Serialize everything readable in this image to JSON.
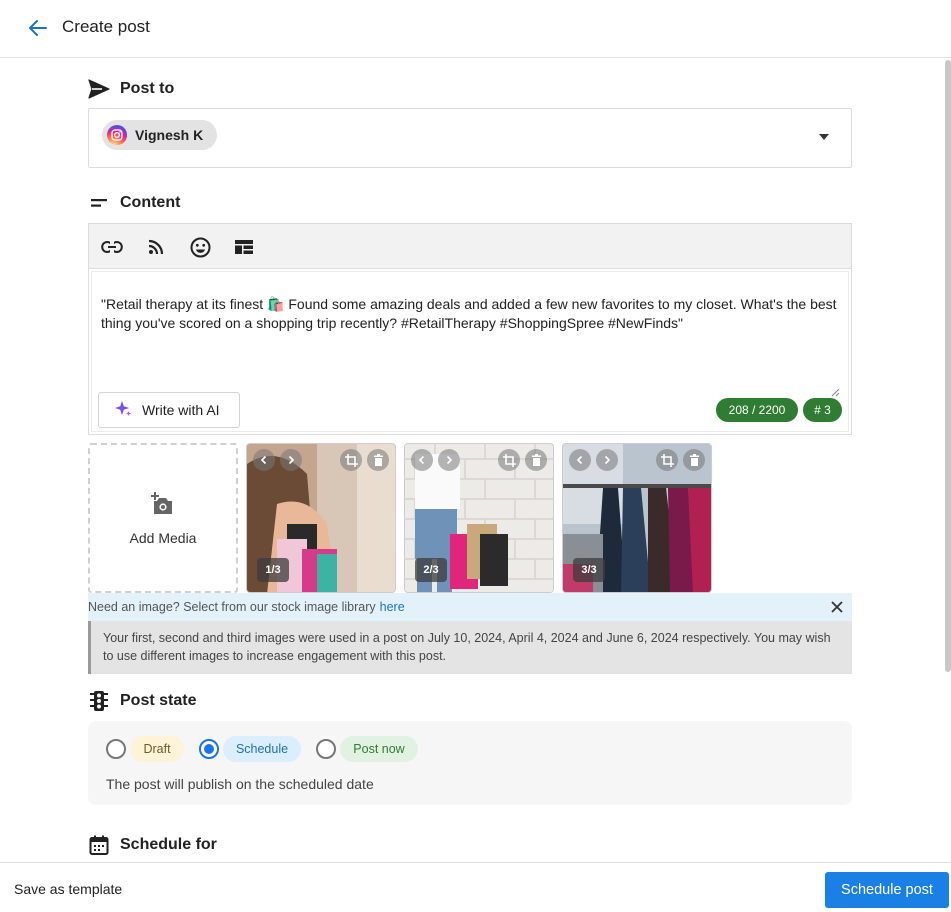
{
  "header": {
    "title": "Create post",
    "back_icon": "arrow-left-icon"
  },
  "post_to": {
    "heading": "Post to",
    "account_name": "Vignesh K",
    "account_icon": "instagram-icon"
  },
  "content": {
    "heading": "Content",
    "toolbar_icons": [
      "link-icon",
      "rss-icon",
      "emoji-icon",
      "layout-icon"
    ],
    "text": "\"Retail therapy at its finest 🛍️ Found some amazing deals and added a few new favorites to my closet. What's the best thing you've scored on a shopping trip recently? #RetailTherapy #ShoppingSpree #NewFinds\"",
    "ai_button": "Write with AI",
    "char_count": "208 / 2200",
    "hashtag_count": "# 3",
    "count_color": "#2e7d32"
  },
  "media": {
    "add_label": "Add Media",
    "items": [
      {
        "badge": "1/3"
      },
      {
        "badge": "2/3"
      },
      {
        "badge": "3/3"
      }
    ]
  },
  "stock": {
    "text": "Need an image? Select from our stock image library",
    "link": "here"
  },
  "warning": "Your first, second and third images were used in a post on July 10, 2024, April 4, 2024 and June 6, 2024 respectively. You may wish to use different images to increase engagement with this post.",
  "post_state": {
    "heading": "Post state",
    "options": [
      {
        "label": "Draft",
        "selected": false
      },
      {
        "label": "Schedule",
        "selected": true
      },
      {
        "label": "Post now",
        "selected": false
      }
    ],
    "note": "The post will publish on the scheduled date"
  },
  "schedule": {
    "heading": "Schedule for"
  },
  "footer": {
    "save_template": "Save as template",
    "schedule_button": "Schedule post"
  },
  "colors": {
    "accent": "#1a80e5",
    "draft_bg": "#fdf3d6",
    "schedule_bg": "#dbeefd",
    "postnow_bg": "#e2f2e2"
  }
}
